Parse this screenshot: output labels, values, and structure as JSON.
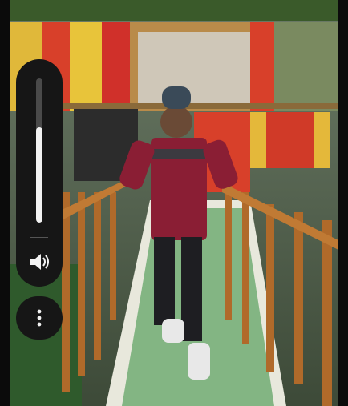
{
  "photo": {
    "subject": "man-standing-on-wooden-bridge"
  },
  "volume": {
    "level_percent": 66,
    "icon": "speaker-icon"
  },
  "more": {
    "icon": "more-vertical-icon"
  },
  "colors": {
    "panel": "#161616",
    "track": "#4a4a4a",
    "fill": "#f2f2f2"
  }
}
